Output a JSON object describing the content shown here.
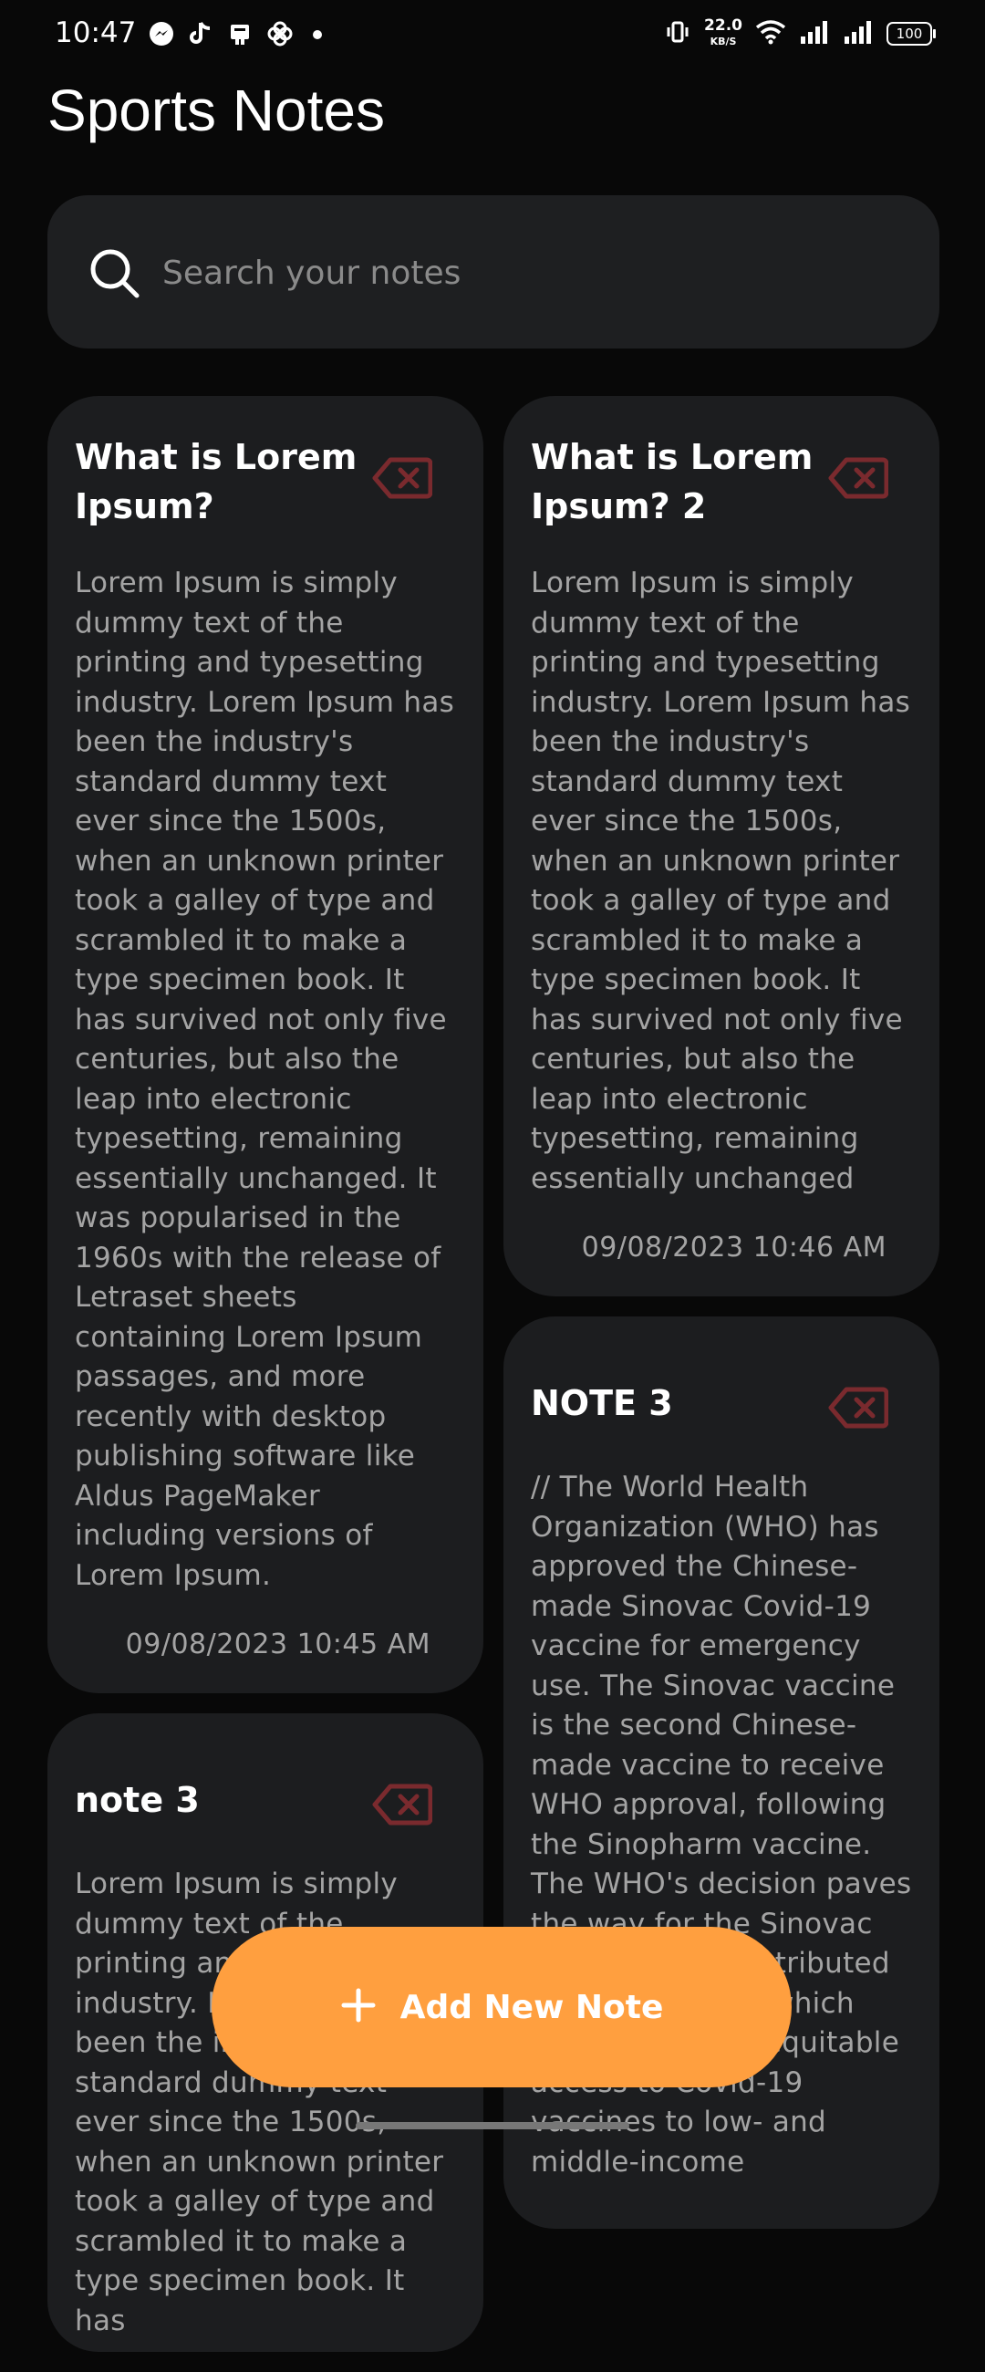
{
  "status_bar": {
    "time": "10:47",
    "speed_value": "22.0",
    "speed_unit": "KB/S",
    "battery": "100"
  },
  "app": {
    "title": "Sports Notes"
  },
  "search": {
    "placeholder": "Search your notes",
    "value": ""
  },
  "notes": [
    {
      "title": "What is Lorem Ipsum?",
      "body": "Lorem Ipsum is simply dummy text of the printing and typesetting industry. Lorem Ipsum has been the industry's standard dummy text ever since the 1500s, when an unknown printer took a galley of type and scrambled it to make a type specimen book. It has survived not only five centuries, but also the leap into electronic typesetting, remaining essentially unchanged. It was popularised in the 1960s with the release of Letraset sheets containing Lorem Ipsum passages, and more recently with desktop publishing software like Aldus PageMaker including versions of Lorem Ipsum.",
      "date": "09/08/2023 10:45 AM"
    },
    {
      "title": "What is Lorem Ipsum? 2",
      "body": "Lorem Ipsum is simply dummy text of the printing and typesetting industry. Lorem Ipsum has been the industry's standard dummy text ever since the 1500s, when an unknown printer took a galley of type and scrambled it to make a type specimen book. It has survived not only five centuries, but also the leap into electronic typesetting, remaining essentially unchanged",
      "date": "09/08/2023 10:46 AM"
    },
    {
      "title": "note 3",
      "body": "Lorem Ipsum is simply dummy text of the printing and typesetting industry. Lorem Ipsum has been the industry's standard dummy text ever since the 1500s, when an unknown printer took a galley of type and scrambled it to make a type specimen book. It has"
    },
    {
      "title": "NOTE 3",
      "body": "// The World Health Organization (WHO) has approved the Chinese-made Sinovac Covid-19 vaccine for emergency use. The Sinovac vaccine is the second Chinese-made vaccine to receive WHO approval, following the Sinopharm vaccine. The WHO's decision paves the way for the Sinovac vaccine to be distributed through COVAX, which aims to provide equitable access to Covid-19 vaccines to low- and middle-income"
    }
  ],
  "fab": {
    "label": "Add New Note"
  },
  "colors": {
    "background": "#080808",
    "card": "#1c1d1f",
    "accent": "#ff9f3f",
    "delete_icon": "#7a2a2e"
  },
  "icons": {
    "search": "search-icon",
    "delete": "backspace-delete-icon",
    "add": "plus-icon"
  }
}
